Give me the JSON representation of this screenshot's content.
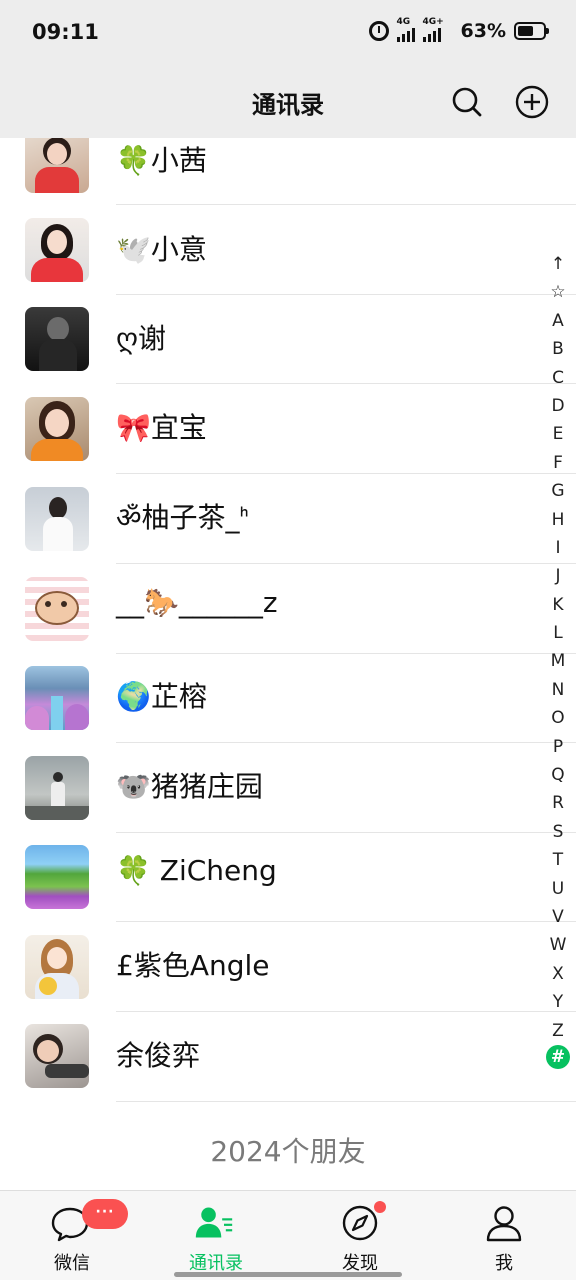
{
  "status_bar": {
    "time": "09:11",
    "signal1_label": "4G",
    "signal2_label": "4G+",
    "battery_percent": "63%",
    "battery_level": 0.63
  },
  "header": {
    "title": "通讯录"
  },
  "contacts": [
    {
      "name": "🍀小茜"
    },
    {
      "name": "🕊️小意"
    },
    {
      "name": "ღ谢"
    },
    {
      "name": "🎀宜宝"
    },
    {
      "name": "ॐ柚子茶_ᑋ"
    },
    {
      "name": "__🐎______z"
    },
    {
      "name": "🌍芷榕"
    },
    {
      "name": "🐨猪猪庄园"
    },
    {
      "name": "🍀 ZiCheng"
    },
    {
      "name": "£紫色Angle"
    },
    {
      "name": "余俊弈"
    }
  ],
  "friend_count": "2024个朋友",
  "index_bar": [
    "↑",
    "☆",
    "A",
    "B",
    "C",
    "D",
    "E",
    "F",
    "G",
    "H",
    "I",
    "J",
    "K",
    "L",
    "M",
    "N",
    "O",
    "P",
    "Q",
    "R",
    "S",
    "T",
    "U",
    "V",
    "W",
    "X",
    "Y",
    "Z",
    "#"
  ],
  "bottom_nav": {
    "chats": "微信",
    "chats_badge": "···",
    "contacts": "通讯录",
    "discover": "发现",
    "me": "我"
  },
  "colors": {
    "accent": "#07c160",
    "badge": "#fa5151",
    "header_bg": "#ededed"
  }
}
